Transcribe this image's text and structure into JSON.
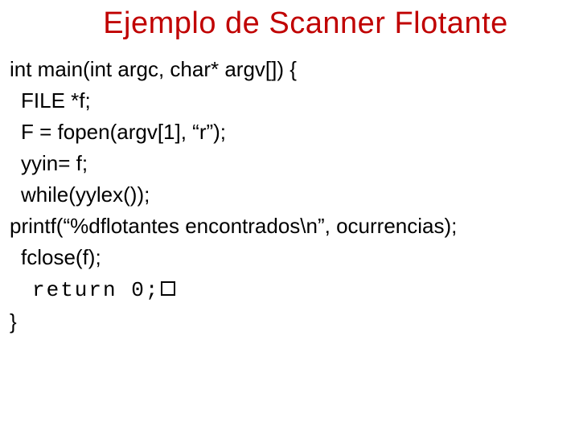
{
  "title": "Ejemplo de Scanner Flotante",
  "code": {
    "l1": "int main(int argc, char* argv[]) {",
    "l2": "FILE *f;",
    "l3": "F = fopen(argv[1], “r”);",
    "l4": "yyin= f;",
    "l5": "while(yylex());",
    "l6": "printf(“%dflotantes encontrados\\n”, ocurrencias);",
    "l7": "fclose(f);",
    "l8": "return 0;",
    "l9": "}"
  }
}
